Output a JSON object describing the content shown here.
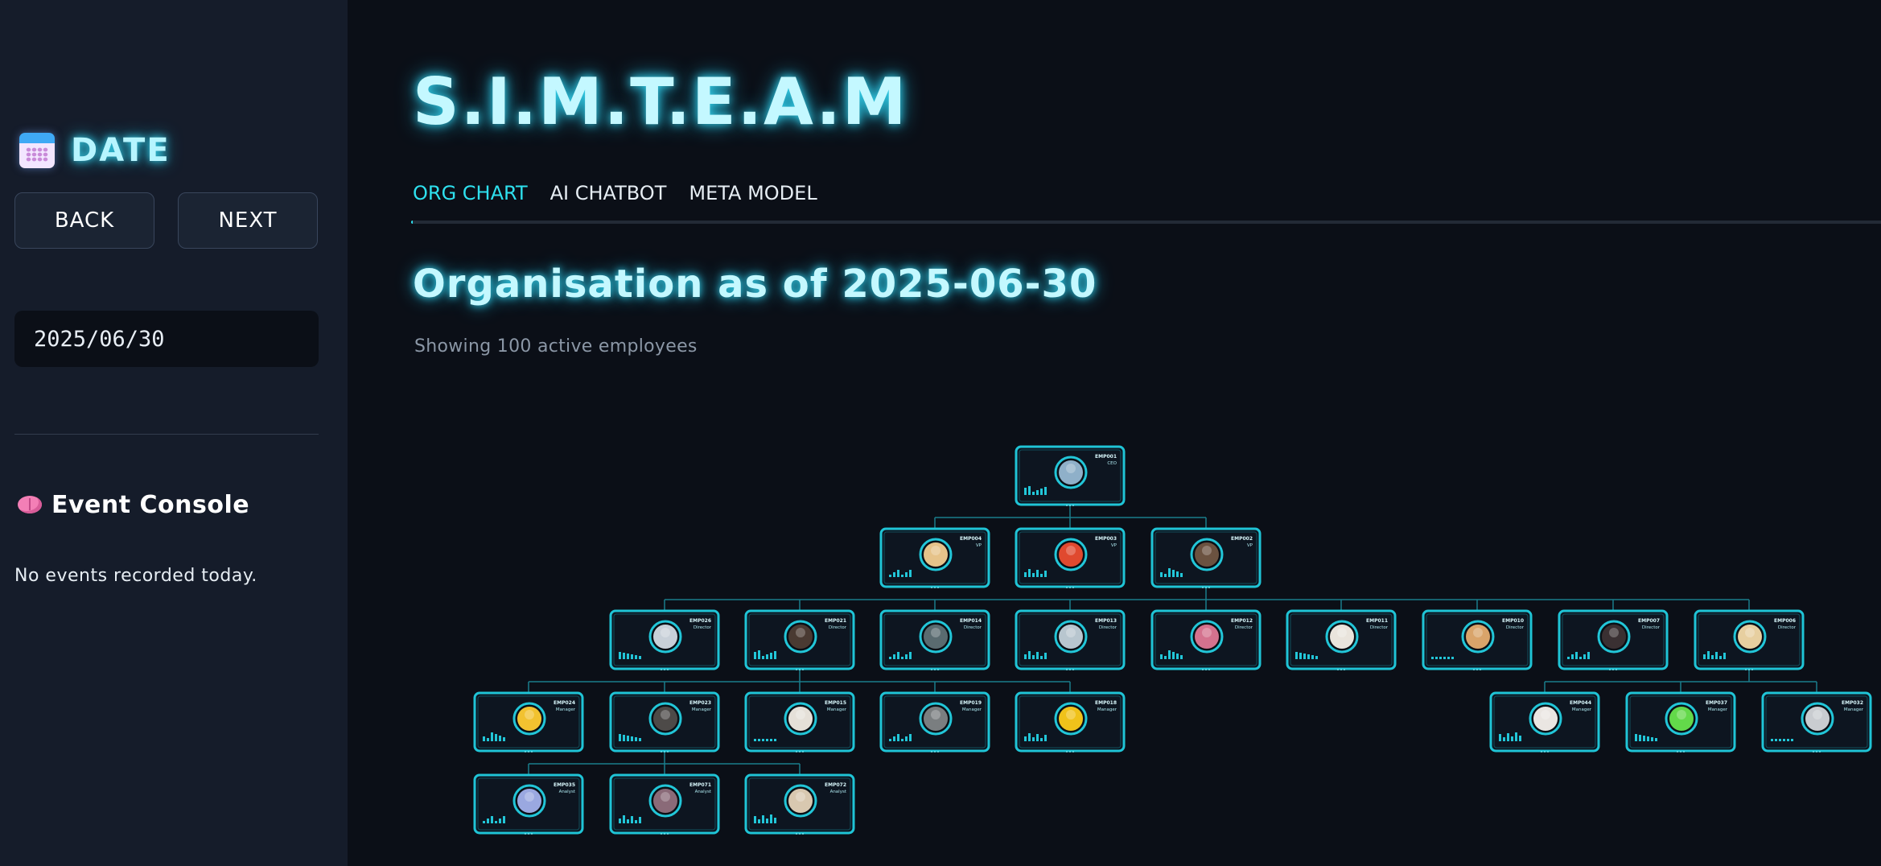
{
  "sidebar": {
    "date_title": "DATE",
    "back_label": "BACK",
    "next_label": "NEXT",
    "date_value": "2025/06/30",
    "console_title": "Event Console",
    "no_events": "No events recorded today."
  },
  "header": {
    "title": "S.I.M.T.E.A.M",
    "tabs": [
      {
        "label": "ORG CHART",
        "active": true
      },
      {
        "label": "AI CHATBOT",
        "active": false
      },
      {
        "label": "META MODEL",
        "active": false
      }
    ]
  },
  "main": {
    "org_title": "Organisation as of 2025-06-30",
    "subtitle": "Showing 100 active employees"
  },
  "colors": {
    "accent": "#2ee0ee",
    "node_border": "#1fc4d6",
    "connector": "#1a7d8c",
    "background": "#0b0f17",
    "sidebar": "#151c2a"
  },
  "org_chart": {
    "nodes": [
      {
        "id": "EMP001",
        "role": "CEO",
        "parent": null,
        "avatar": "#8fb0c9"
      },
      {
        "id": "EMP004",
        "role": "VP",
        "parent": "EMP001",
        "avatar": "#e6c38a"
      },
      {
        "id": "EMP003",
        "role": "VP",
        "parent": "EMP001",
        "avatar": "#e0492f"
      },
      {
        "id": "EMP002",
        "role": "VP",
        "parent": "EMP001",
        "avatar": "#6b5240"
      },
      {
        "id": "EMP026",
        "role": "Director",
        "parent": "EMP002",
        "avatar": "#c8d0d8"
      },
      {
        "id": "EMP021",
        "role": "Director",
        "parent": "EMP002",
        "avatar": "#4a3a32"
      },
      {
        "id": "EMP014",
        "role": "Director",
        "parent": "EMP002",
        "avatar": "#5a6b70"
      },
      {
        "id": "EMP013",
        "role": "Director",
        "parent": "EMP002",
        "avatar": "#b8c6cf"
      },
      {
        "id": "EMP012",
        "role": "Director",
        "parent": "EMP002",
        "avatar": "#d4728e"
      },
      {
        "id": "EMP011",
        "role": "Director",
        "parent": "EMP002",
        "avatar": "#e9e4dc"
      },
      {
        "id": "EMP010",
        "role": "Director",
        "parent": "EMP002",
        "avatar": "#d9a46a"
      },
      {
        "id": "EMP007",
        "role": "Director",
        "parent": "EMP002",
        "avatar": "#3a3032"
      },
      {
        "id": "EMP006",
        "role": "Director",
        "parent": "EMP002",
        "avatar": "#e7cfa0"
      },
      {
        "id": "EMP024",
        "role": "Manager",
        "parent": "EMP021",
        "avatar": "#f2c230"
      },
      {
        "id": "EMP023",
        "role": "Manager",
        "parent": "EMP021",
        "avatar": "#4d4a48"
      },
      {
        "id": "EMP015",
        "role": "Manager",
        "parent": "EMP021",
        "avatar": "#e5e0d8"
      },
      {
        "id": "EMP019",
        "role": "Manager",
        "parent": "EMP021",
        "avatar": "#7a7e80"
      },
      {
        "id": "EMP018",
        "role": "Manager",
        "parent": "EMP021",
        "avatar": "#f0c21a"
      },
      {
        "id": "EMP044",
        "role": "Manager",
        "parent": "EMP006",
        "avatar": "#eae6e2"
      },
      {
        "id": "EMP037",
        "role": "Manager",
        "parent": "EMP006",
        "avatar": "#63d94a"
      },
      {
        "id": "EMP032",
        "role": "Manager",
        "parent": "EMP006",
        "avatar": "#c9ccd0"
      },
      {
        "id": "EMP035",
        "role": "Analyst",
        "parent": "EMP023",
        "avatar": "#9aa8e0"
      },
      {
        "id": "EMP071",
        "role": "Analyst",
        "parent": "EMP023",
        "avatar": "#8a6a78"
      },
      {
        "id": "EMP072",
        "role": "Analyst",
        "parent": "EMP023",
        "avatar": "#d8c8b0"
      }
    ]
  }
}
